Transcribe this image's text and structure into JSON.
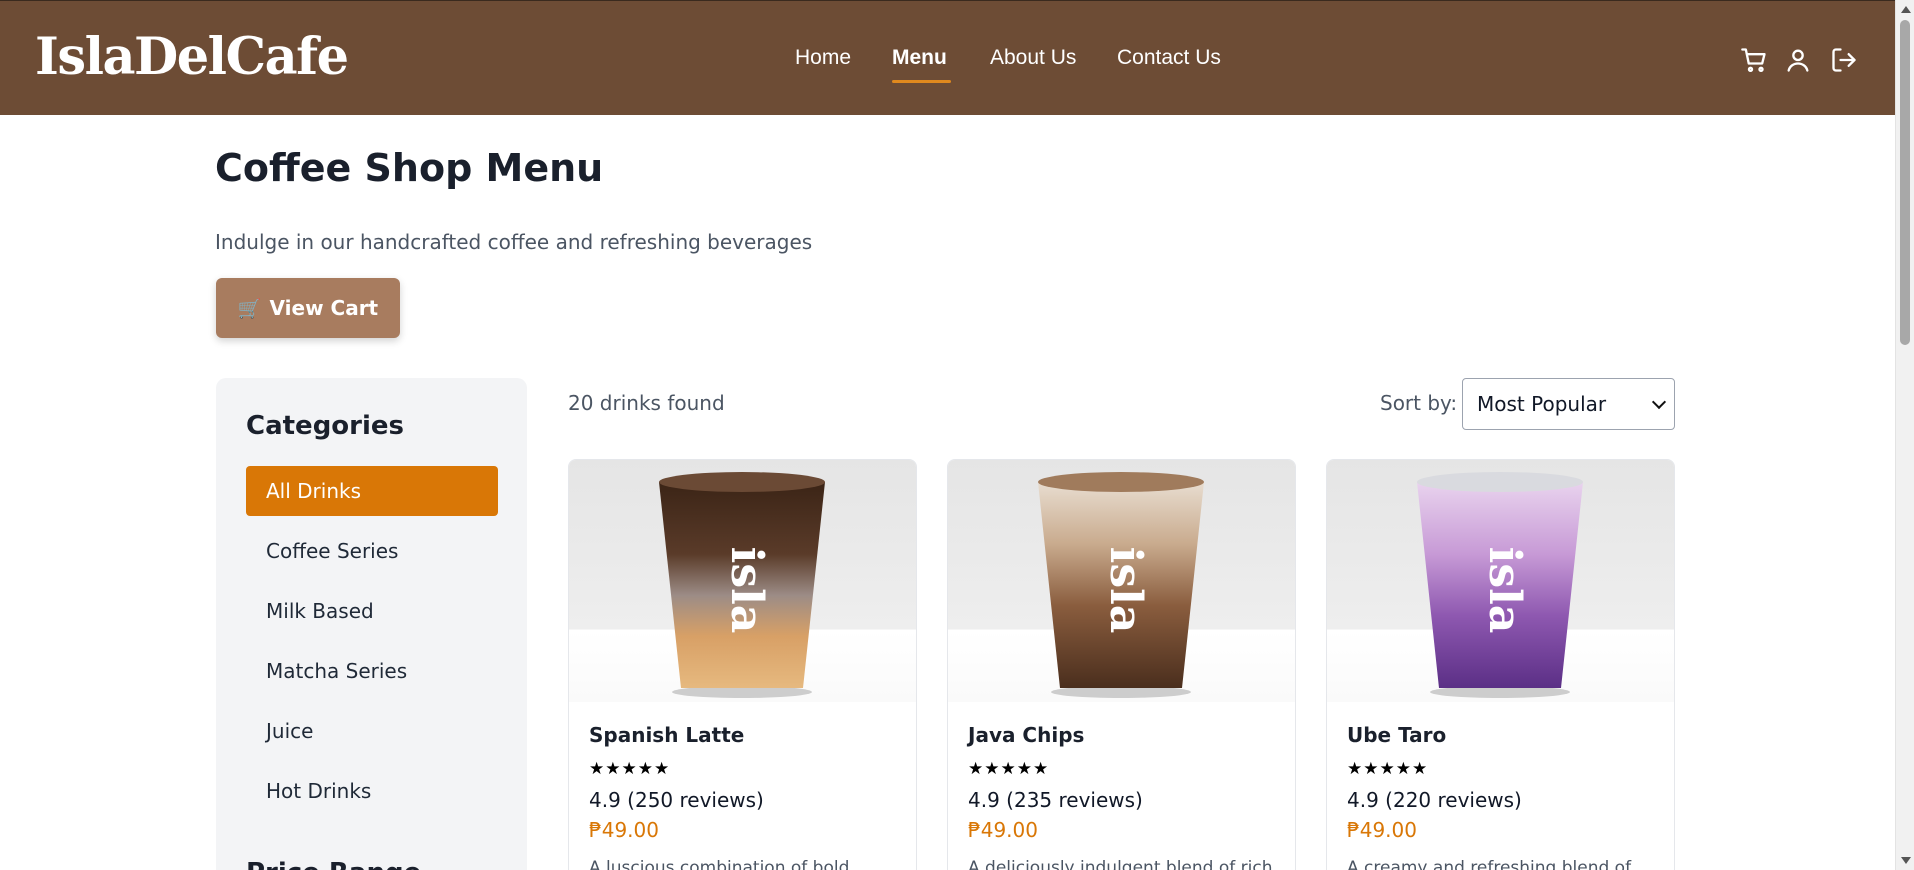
{
  "header": {
    "logo": "IslaDelCafe",
    "nav": [
      {
        "label": "Home",
        "active": false
      },
      {
        "label": "Menu",
        "active": true
      },
      {
        "label": "About Us",
        "active": false
      },
      {
        "label": "Contact Us",
        "active": false
      }
    ],
    "icons": [
      "cart-icon",
      "user-icon",
      "logout-icon"
    ]
  },
  "page": {
    "title": "Coffee Shop Menu",
    "subtitle": "Indulge in our handcrafted coffee and refreshing beverages",
    "cart_button_icon": "🛒",
    "cart_button_label": "View Cart"
  },
  "sidebar": {
    "title": "Categories",
    "categories": [
      {
        "label": "All Drinks",
        "active": true
      },
      {
        "label": "Coffee Series",
        "active": false
      },
      {
        "label": "Milk Based",
        "active": false
      },
      {
        "label": "Matcha Series",
        "active": false
      },
      {
        "label": "Juice",
        "active": false
      },
      {
        "label": "Hot Drinks",
        "active": false
      }
    ],
    "next_section_title": "Price Range"
  },
  "results": {
    "count_text": "20 drinks found",
    "sort_label": "Sort by:",
    "sort_selected": "Most Popular"
  },
  "products": [
    {
      "name": "Spanish Latte",
      "stars": "★★★★★",
      "rating": "4.9 (250 reviews)",
      "price": "₱49.00",
      "description": "A luscious combination of bold",
      "cup_brand": "isla"
    },
    {
      "name": "Java Chips",
      "stars": "★★★★★",
      "rating": "4.9 (235 reviews)",
      "price": "₱49.00",
      "description": "A deliciously indulgent blend of rich",
      "cup_brand": "isla"
    },
    {
      "name": "Ube Taro",
      "stars": "★★★★★",
      "rating": "4.9 (220 reviews)",
      "price": "₱49.00",
      "description": "A creamy and refreshing blend of",
      "cup_brand": "isla"
    }
  ],
  "colors": {
    "header_bg": "#6d4c35",
    "accent": "#d97706",
    "cart_button_bg": "#a87c5f",
    "sidebar_bg": "#f3f4f6"
  }
}
